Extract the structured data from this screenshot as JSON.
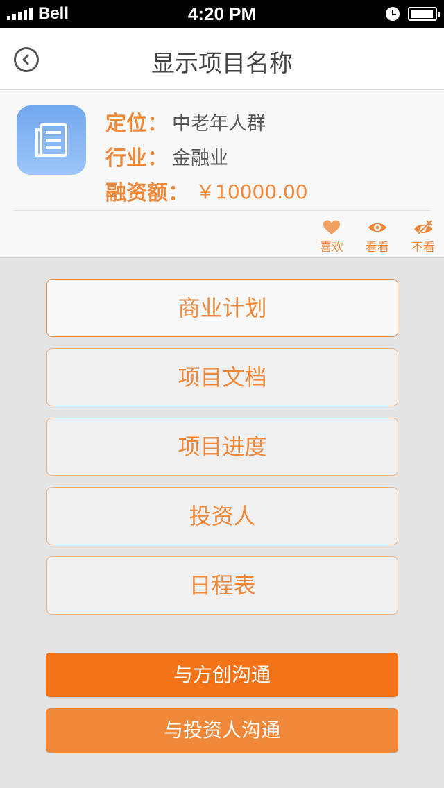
{
  "status_bar": {
    "carrier": "Bell",
    "time": "4:20 PM",
    "battery_level": 0.95
  },
  "nav": {
    "title": "显示项目名称",
    "back_icon": "back-circle-icon"
  },
  "project": {
    "icon": "document-icon",
    "rows": [
      {
        "label": "定位：",
        "value": "中老年人群"
      },
      {
        "label": "行业：",
        "value": "金融业"
      },
      {
        "label": "融资额：",
        "value": "￥10000.00"
      }
    ],
    "actions": [
      {
        "icon": "heart-icon",
        "label": "喜欢"
      },
      {
        "icon": "eye-icon",
        "label": "看看"
      },
      {
        "icon": "eye-off-icon",
        "label": "不看"
      }
    ]
  },
  "menu": [
    "商业计划",
    "项目文档",
    "项目进度",
    "投资人",
    "日程表"
  ],
  "cta": {
    "primary": "与方创沟通",
    "secondary": "与投资人沟通"
  },
  "colors": {
    "accent": "#f0883a",
    "primary_button": "#f27318",
    "icon_bg": "#72a8ee"
  }
}
